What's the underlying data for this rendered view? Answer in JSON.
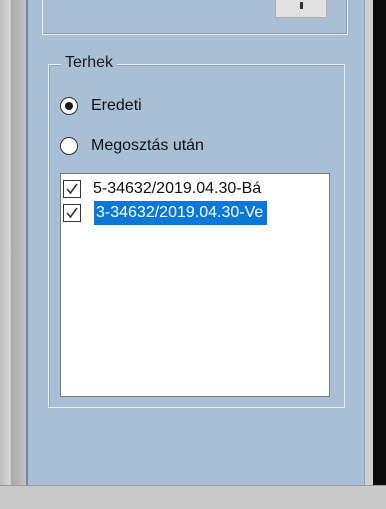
{
  "group": {
    "title": "Terhek"
  },
  "radios": [
    {
      "label": "Eredeti",
      "checked": true
    },
    {
      "label": "Megosztás után",
      "checked": false
    }
  ],
  "list": {
    "items": [
      {
        "text": "5-34632/2019.04.30-Bá",
        "checked": true,
        "selected": false
      },
      {
        "text": "3-34632/2019.04.30-Ve",
        "checked": true,
        "selected": true
      }
    ]
  },
  "colors": {
    "panel": "#a8bfd6",
    "selection": "#0a78d7"
  }
}
